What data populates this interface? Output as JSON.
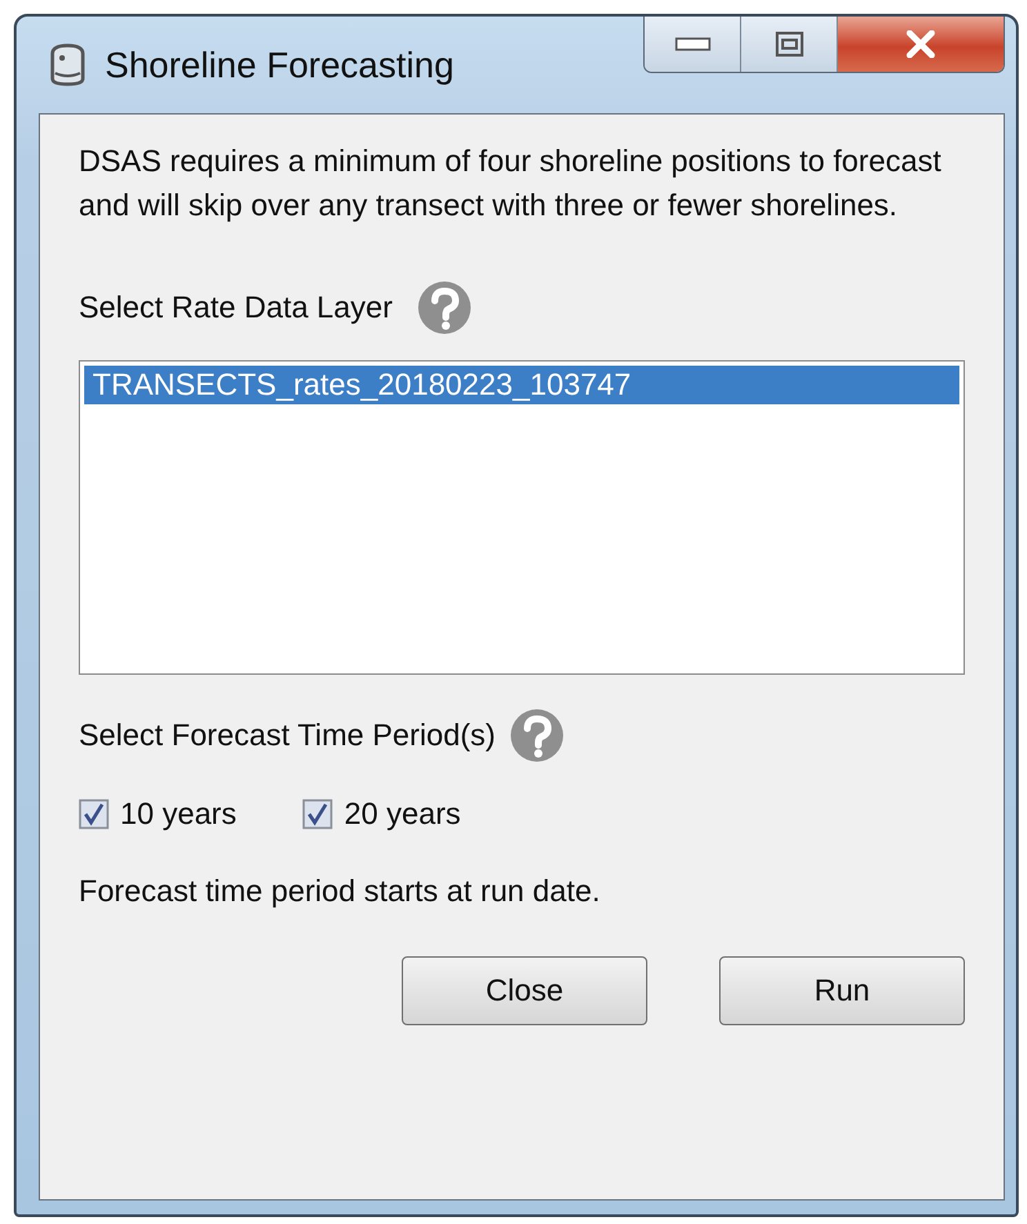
{
  "window": {
    "title": "Shoreline Forecasting"
  },
  "intro": "DSAS requires a minimum of four shoreline positions to forecast and will skip over any transect with three or fewer shorelines.",
  "rate_layer": {
    "label": "Select Rate Data Layer",
    "items": [
      {
        "label": "TRANSECTS_rates_20180223_103747",
        "selected": true
      }
    ]
  },
  "time_period": {
    "label": "Select Forecast Time Period(s)",
    "options": [
      {
        "label": "10 years",
        "checked": true
      },
      {
        "label": "20 years",
        "checked": true
      }
    ]
  },
  "note": "Forecast time period starts at run date.",
  "buttons": [
    "Close",
    "Run"
  ]
}
